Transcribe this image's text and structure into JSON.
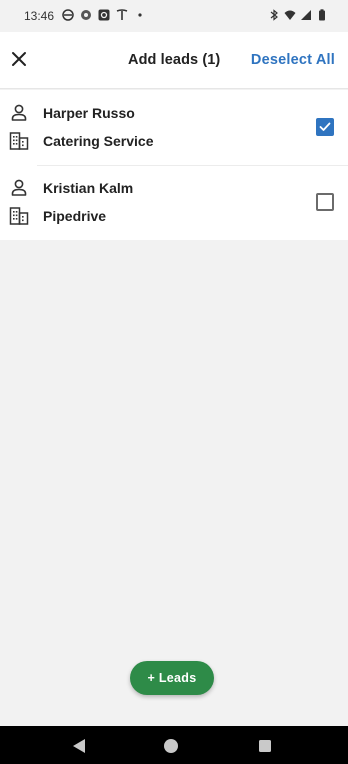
{
  "status_bar": {
    "time": "13:46",
    "left_icons": [
      "circle-status-icon",
      "chrome-icon",
      "camera-app-icon",
      "tesla-icon",
      "dot-icon"
    ],
    "right_icons": [
      "bluetooth-icon",
      "wifi-icon",
      "signal-icon",
      "battery-icon"
    ]
  },
  "header": {
    "title": "Add leads (1)",
    "deselect_label": "Deselect All",
    "accent_color": "#2f74c0"
  },
  "leads": [
    {
      "person": "Harper Russo",
      "organization": "Catering Service",
      "checked": true
    },
    {
      "person": "Kristian Kalm",
      "organization": "Pipedrive",
      "checked": false
    }
  ],
  "fab": {
    "label": "+ Leads",
    "color": "#2e8b48"
  },
  "nav_bar": {
    "buttons": [
      "back",
      "home",
      "recents"
    ]
  }
}
